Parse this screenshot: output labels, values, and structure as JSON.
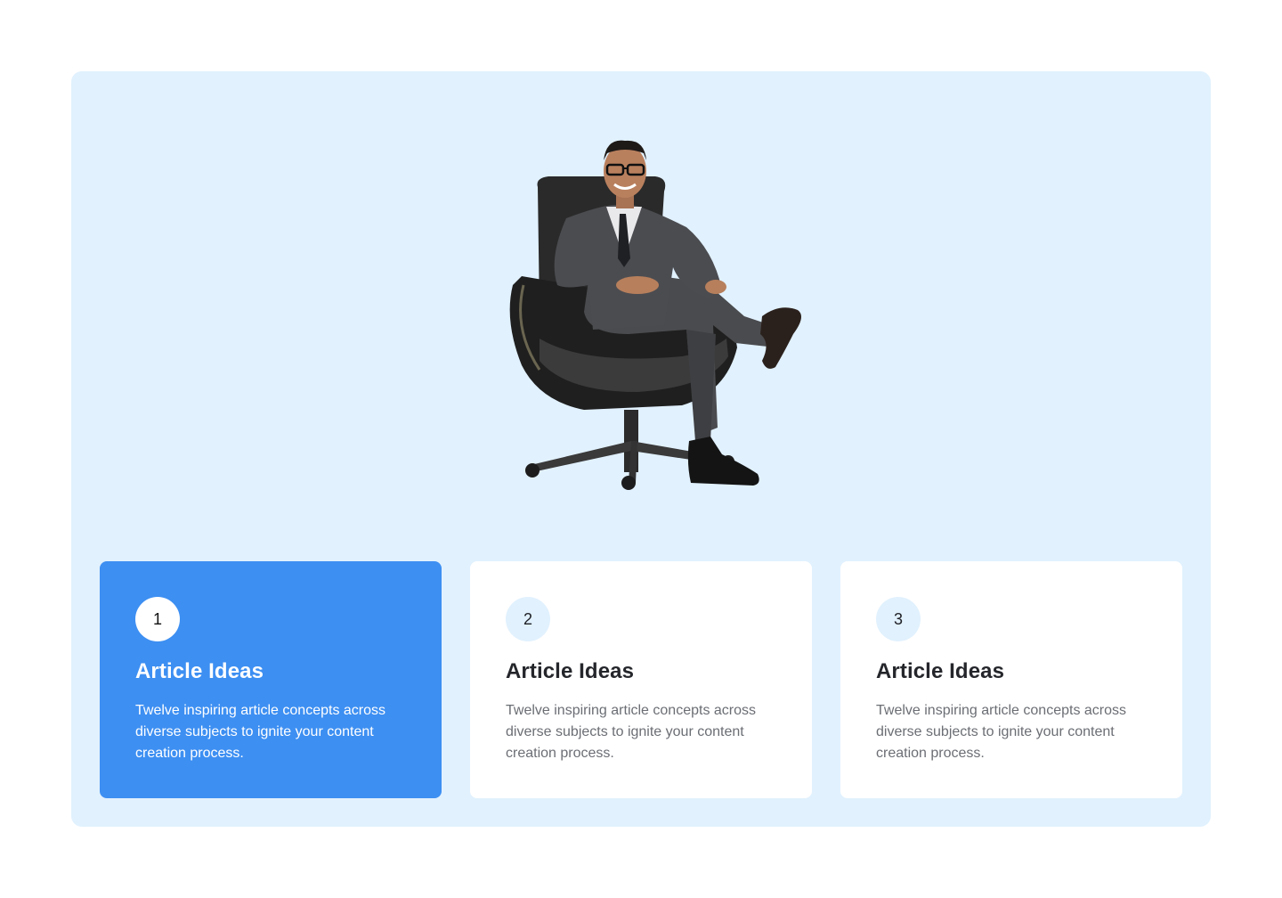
{
  "hero": {
    "image": "businessman-in-office-chair"
  },
  "colors": {
    "panel_bg": "#e1f1fe",
    "active_card_bg": "#3d8ff2",
    "card_bg": "#ffffff"
  },
  "cards": [
    {
      "number": "1",
      "title": "Article Ideas",
      "description": "Twelve inspiring article concepts across diverse subjects to ignite your content creation process.",
      "active": true
    },
    {
      "number": "2",
      "title": "Article Ideas",
      "description": "Twelve inspiring article concepts across diverse subjects to ignite your content creation process.",
      "active": false
    },
    {
      "number": "3",
      "title": "Article Ideas",
      "description": "Twelve inspiring article concepts across diverse subjects to ignite your content creation process.",
      "active": false
    }
  ]
}
